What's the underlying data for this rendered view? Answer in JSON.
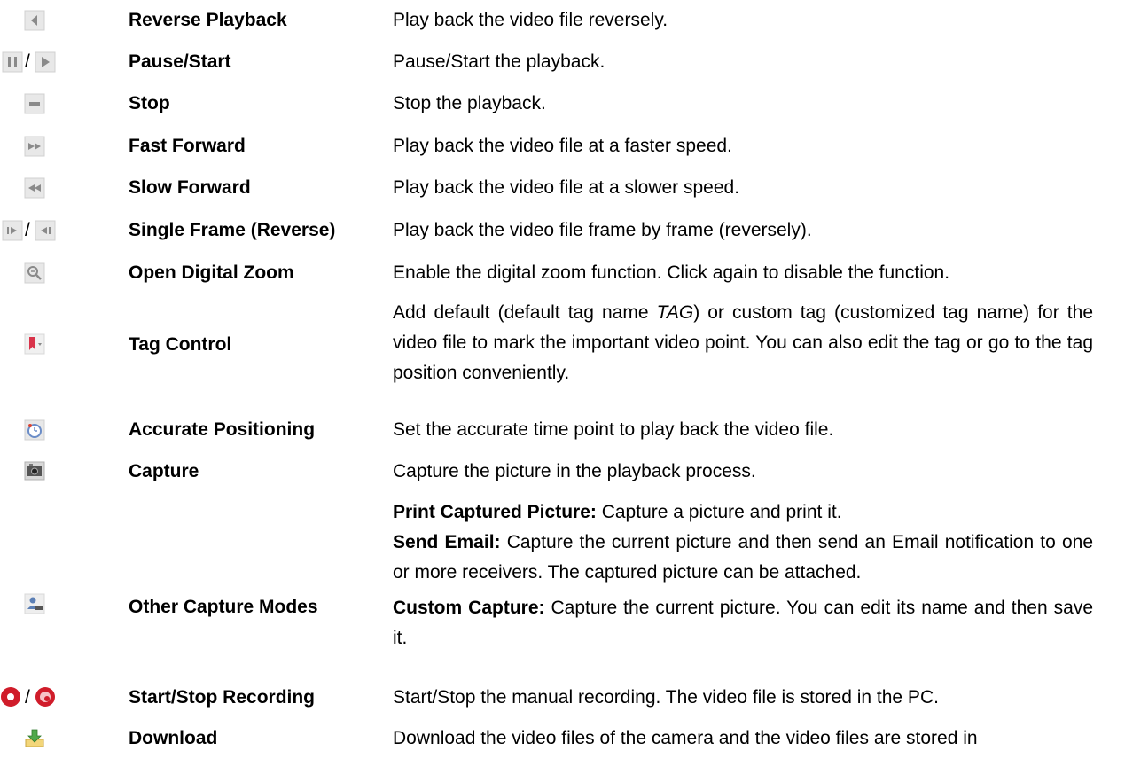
{
  "rows": [
    {
      "name": "Reverse Playback",
      "desc": "Play back the video file reversely.",
      "icons": [
        "reverse-playback-icon"
      ]
    },
    {
      "name": "Pause/Start",
      "desc": "Pause/Start the playback.",
      "icons": [
        "pause-icon",
        "start-icon"
      ],
      "separator": "/"
    },
    {
      "name": "Stop",
      "desc": "Stop the playback.",
      "icons": [
        "stop-icon"
      ]
    },
    {
      "name": "Fast Forward",
      "desc": "Play back the video file at a faster speed.",
      "icons": [
        "fast-forward-icon"
      ]
    },
    {
      "name": "Slow Forward",
      "desc": "Play back the video file at a slower speed.",
      "icons": [
        "slow-forward-icon"
      ]
    },
    {
      "name": "Single Frame (Reverse)",
      "desc": "Play back the video file frame by frame (reversely).",
      "icons": [
        "single-frame-icon",
        "single-frame-reverse-icon"
      ],
      "separator": "/"
    },
    {
      "name": "Open Digital Zoom",
      "desc": "Enable the digital zoom function. Click again to disable the function.",
      "icons": [
        "digital-zoom-icon"
      ]
    },
    {
      "name": "Tag Control",
      "desc_parts": {
        "a": "Add default (default tag name ",
        "tag": "TAG",
        "b": ") or custom tag (customized tag name) for the video file to mark the important video point. You can also edit the tag or go to the tag position conveniently."
      },
      "icons": [
        "tag-icon"
      ]
    },
    {
      "name": "Accurate Positioning",
      "desc": "Set the accurate time point to play back the video file.",
      "icons": [
        "clock-icon"
      ]
    },
    {
      "name": "Capture",
      "desc": "Capture the picture in the playback process.",
      "icons": [
        "camera-icon"
      ]
    },
    {
      "name": "Other Capture Modes",
      "items": [
        {
          "label": "Print Captured Picture:",
          "text": " Capture a picture and print it."
        },
        {
          "label": "Send Email:",
          "text": " Capture the current picture and then send an Email notification to one or more receivers. The captured picture can be attached."
        },
        {
          "label": "Custom Capture:",
          "text": " Capture the current picture. You can edit its name and then save it."
        }
      ],
      "icons": [
        "capture-modes-icon"
      ]
    },
    {
      "name": "Start/Stop Recording",
      "desc": "Start/Stop the manual recording. The video file is stored in the PC.",
      "icons": [
        "record-start-icon",
        "record-stop-icon"
      ],
      "separator": "/"
    },
    {
      "name": "Download",
      "desc": "Download the video files of the camera and the video files are stored in",
      "icons": [
        "download-icon"
      ]
    }
  ],
  "colors": {
    "icon_bg": "#e6e6e6",
    "icon_fg": "#8c8c8c",
    "tag_red": "#d9334a",
    "record_red": "#d01c2a"
  }
}
